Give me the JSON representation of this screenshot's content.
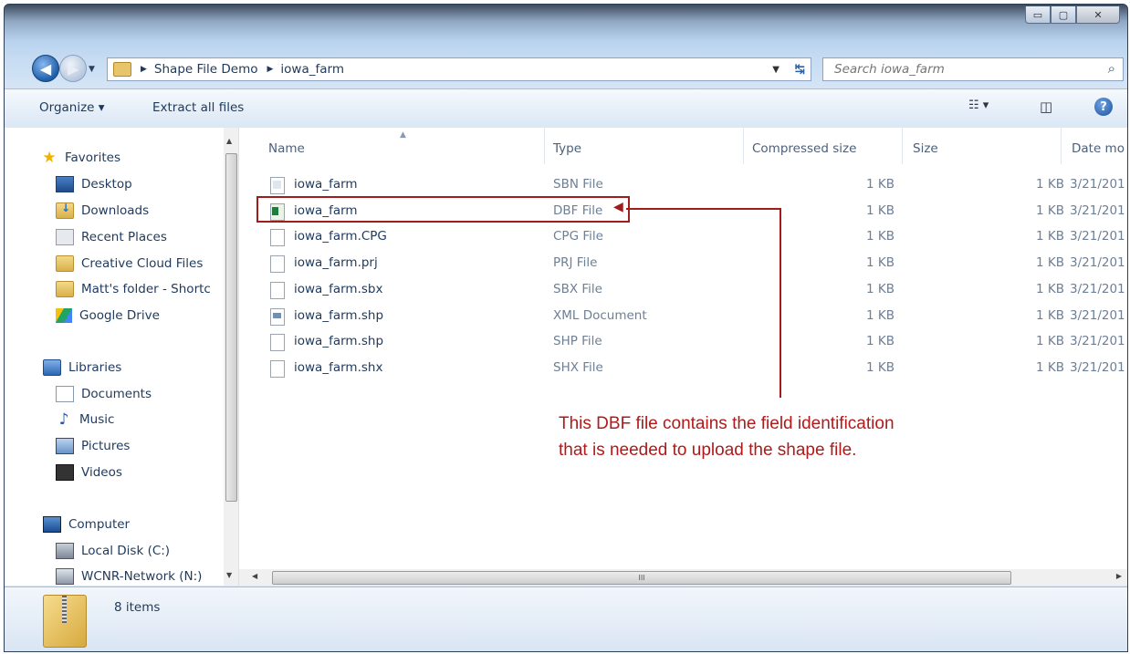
{
  "window": {
    "controls": {
      "minimize": "▭",
      "maximize": "▢",
      "close": "✕"
    }
  },
  "address": {
    "crumbs": [
      "Shape File Demo",
      "iowa_farm"
    ],
    "search_placeholder": "Search iowa_farm"
  },
  "toolbar": {
    "organize": "Organize ▾",
    "extract": "Extract all files"
  },
  "nav": {
    "favorites": "Favorites",
    "favorite_items": [
      "Desktop",
      "Downloads",
      "Recent Places",
      "Creative Cloud Files",
      "Matt's folder - Shortc",
      "Google Drive"
    ],
    "libraries": "Libraries",
    "library_items": [
      "Documents",
      "Music",
      "Pictures",
      "Videos"
    ],
    "computer": "Computer",
    "computer_items": [
      "Local Disk (C:)",
      "WCNR-Network (N:)"
    ]
  },
  "columns": {
    "name": "Name",
    "type": "Type",
    "compressed": "Compressed size",
    "size": "Size",
    "date": "Date mo"
  },
  "files": [
    {
      "name": "iowa_farm",
      "type": "SBN File",
      "compressed": "1 KB",
      "size": "1 KB",
      "date": "3/21/201",
      "icon": "sbn-file-icon"
    },
    {
      "name": "iowa_farm",
      "type": "DBF File",
      "compressed": "1 KB",
      "size": "1 KB",
      "date": "3/21/201",
      "icon": "dbf-file-icon"
    },
    {
      "name": "iowa_farm.CPG",
      "type": "CPG File",
      "compressed": "1 KB",
      "size": "1 KB",
      "date": "3/21/201",
      "icon": "blank-file-icon"
    },
    {
      "name": "iowa_farm.prj",
      "type": "PRJ File",
      "compressed": "1 KB",
      "size": "1 KB",
      "date": "3/21/201",
      "icon": "blank-file-icon"
    },
    {
      "name": "iowa_farm.sbx",
      "type": "SBX File",
      "compressed": "1 KB",
      "size": "1 KB",
      "date": "3/21/201",
      "icon": "blank-file-icon"
    },
    {
      "name": "iowa_farm.shp",
      "type": "XML Document",
      "compressed": "1 KB",
      "size": "1 KB",
      "date": "3/21/201",
      "icon": "xml-file-icon"
    },
    {
      "name": "iowa_farm.shp",
      "type": "SHP File",
      "compressed": "1 KB",
      "size": "1 KB",
      "date": "3/21/201",
      "icon": "blank-file-icon"
    },
    {
      "name": "iowa_farm.shx",
      "type": "SHX File",
      "compressed": "1 KB",
      "size": "1 KB",
      "date": "3/21/201",
      "icon": "blank-file-icon"
    }
  ],
  "annotation": {
    "line1": "This DBF file contains the field identification",
    "line2": "that is needed to upload the shape file.",
    "color": "#b01a1a"
  },
  "status": {
    "items_count": "8 items"
  },
  "scrollbar": {
    "grip": "III"
  }
}
